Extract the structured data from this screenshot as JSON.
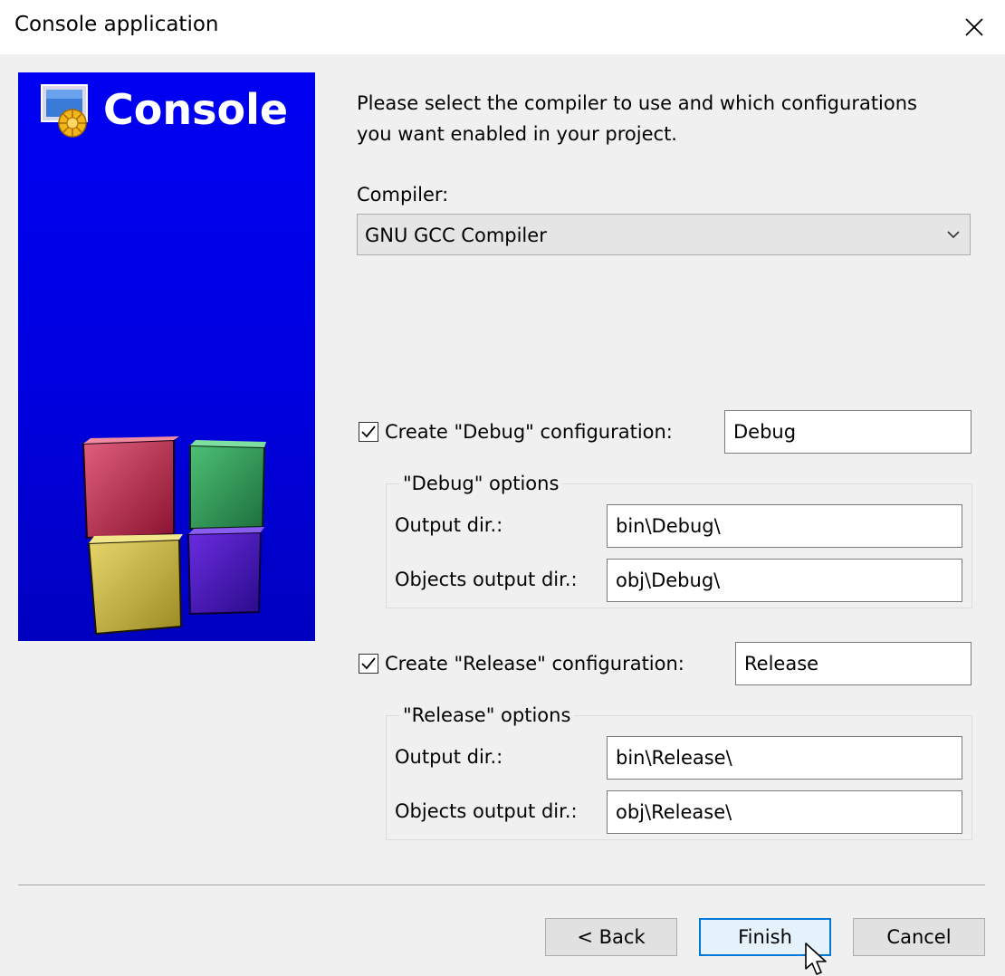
{
  "window": {
    "title": "Console application"
  },
  "banner": {
    "title": "Console"
  },
  "intro": {
    "line1": "Please select the compiler to use and which configurations",
    "line2": "you want enabled in your project."
  },
  "compiler": {
    "label": "Compiler:",
    "selected": "GNU GCC Compiler"
  },
  "debug": {
    "checkbox_label": "Create \"Debug\" configuration:",
    "checked": true,
    "name_value": "Debug",
    "group_label": "\"Debug\" options",
    "output_dir_label": "Output dir.:",
    "output_dir_value": "bin\\Debug\\",
    "objects_dir_label": "Objects output dir.:",
    "objects_dir_value": "obj\\Debug\\"
  },
  "release": {
    "checkbox_label": "Create \"Release\" configuration:",
    "checked": true,
    "name_value": "Release",
    "group_label": "\"Release\" options",
    "output_dir_label": "Output dir.:",
    "output_dir_value": "bin\\Release\\",
    "objects_dir_label": "Objects output dir.:",
    "objects_dir_value": "obj\\Release\\"
  },
  "buttons": {
    "back": "< Back",
    "finish": "Finish",
    "cancel": "Cancel"
  },
  "icons": {
    "close": "close-icon",
    "dropdown": "chevron-down-icon",
    "check": "checkmark-icon",
    "logo": "codeblocks-console-logo",
    "cubes": "codeblocks-cubes-logo",
    "cursor": "mouse-pointer-icon"
  },
  "colors": {
    "banner_blue": "#0000e8",
    "default_button_border": "#0078d7",
    "dialog_background": "#f0f0f0"
  }
}
